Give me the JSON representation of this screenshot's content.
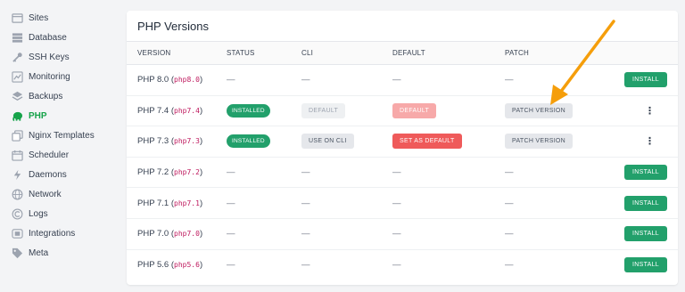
{
  "sidebar": {
    "items": [
      {
        "label": "Sites",
        "icon": "window-icon"
      },
      {
        "label": "Database",
        "icon": "database-icon"
      },
      {
        "label": "SSH Keys",
        "icon": "key-icon"
      },
      {
        "label": "Monitoring",
        "icon": "chart-icon"
      },
      {
        "label": "Backups",
        "icon": "layers-icon"
      },
      {
        "label": "PHP",
        "icon": "elephant-icon"
      },
      {
        "label": "Nginx Templates",
        "icon": "copy-icon"
      },
      {
        "label": "Scheduler",
        "icon": "calendar-icon"
      },
      {
        "label": "Daemons",
        "icon": "bolt-icon"
      },
      {
        "label": "Network",
        "icon": "globe-icon"
      },
      {
        "label": "Logs",
        "icon": "logs-icon"
      },
      {
        "label": "Integrations",
        "icon": "plug-icon"
      },
      {
        "label": "Meta",
        "icon": "tag-icon"
      }
    ],
    "active": "PHP"
  },
  "card": {
    "title": "PHP Versions"
  },
  "table": {
    "headers": [
      "VERSION",
      "STATUS",
      "CLI",
      "DEFAULT",
      "PATCH"
    ],
    "dash": "—",
    "rows": [
      {
        "version": "PHP 8.0",
        "alias": "php8.0",
        "status": "",
        "cli": "",
        "default": "",
        "patch": "",
        "action": "INSTALL"
      },
      {
        "version": "PHP 7.4",
        "alias": "php7.4",
        "status": "INSTALLED",
        "cli": "DEFAULT",
        "default": "DEFAULT",
        "patch": "PATCH VERSION",
        "action": "menu"
      },
      {
        "version": "PHP 7.3",
        "alias": "php7.3",
        "status": "INSTALLED",
        "cli": "USE ON CLI",
        "default": "SET AS DEFAULT",
        "patch": "PATCH VERSION",
        "action": "menu"
      },
      {
        "version": "PHP 7.2",
        "alias": "php7.2",
        "status": "",
        "cli": "",
        "default": "",
        "patch": "",
        "action": "INSTALL"
      },
      {
        "version": "PHP 7.1",
        "alias": "php7.1",
        "status": "",
        "cli": "",
        "default": "",
        "patch": "",
        "action": "INSTALL"
      },
      {
        "version": "PHP 7.0",
        "alias": "php7.0",
        "status": "",
        "cli": "",
        "default": "",
        "patch": "",
        "action": "INSTALL"
      },
      {
        "version": "PHP 5.6",
        "alias": "php5.6",
        "status": "",
        "cli": "",
        "default": "",
        "patch": "",
        "action": "INSTALL"
      }
    ]
  },
  "colors": {
    "accent_green": "#22a06b",
    "danger_red": "#ef5a5a",
    "annotation_arrow": "#f59e0b"
  }
}
